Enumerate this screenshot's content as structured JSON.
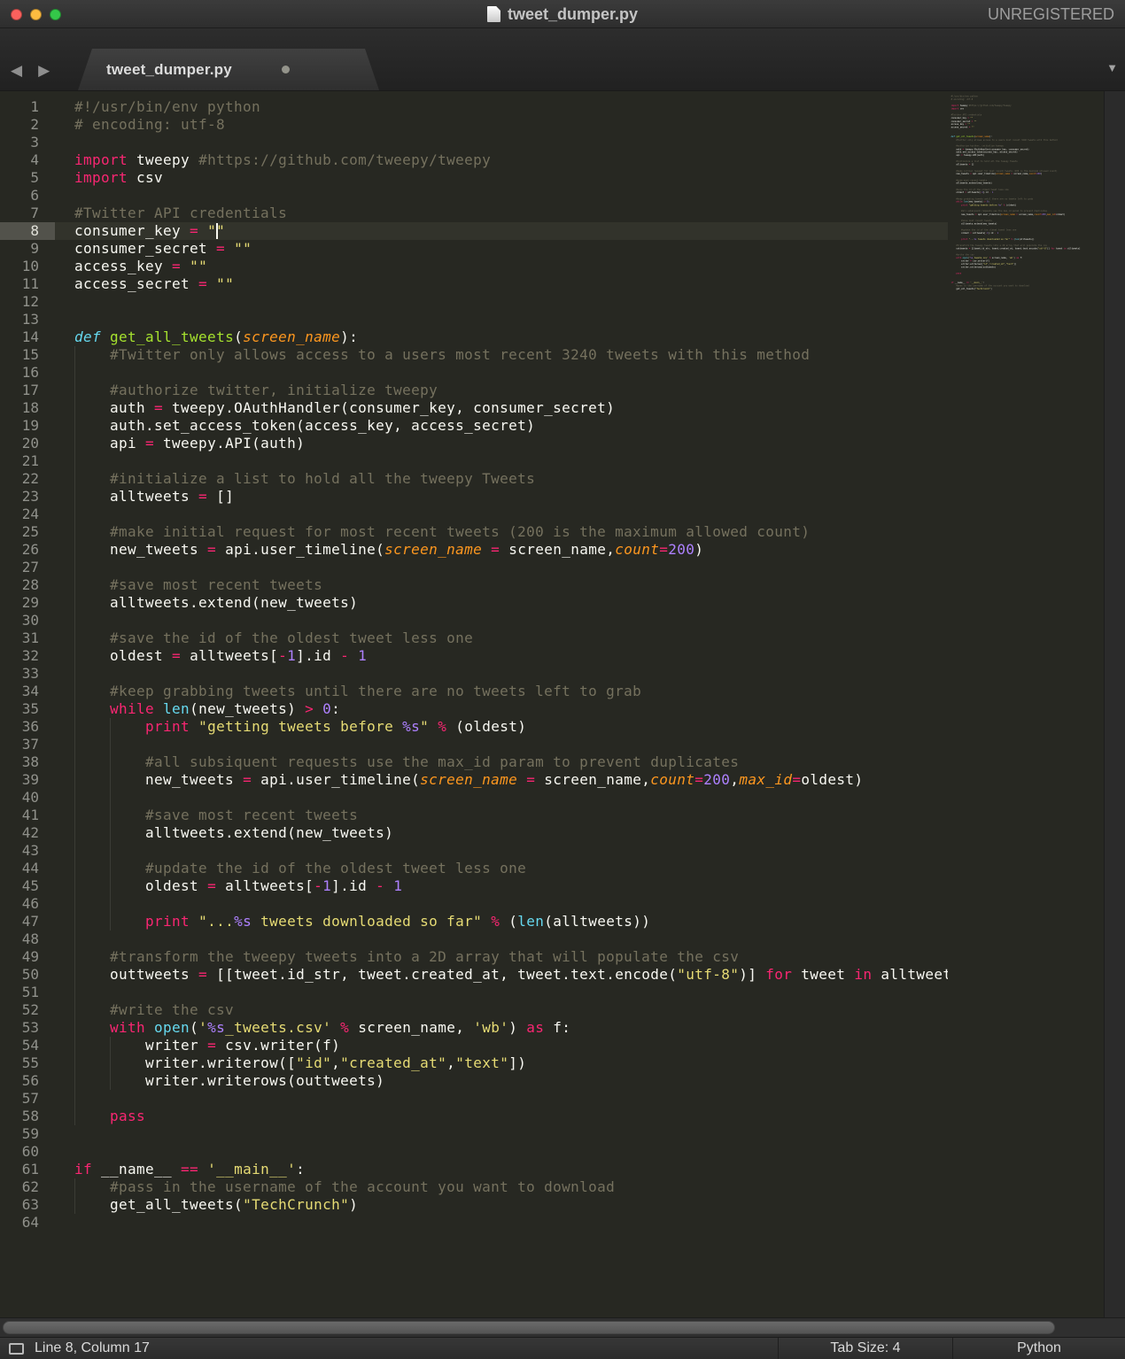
{
  "window": {
    "title": "tweet_dumper.py",
    "registration_status": "UNREGISTERED"
  },
  "icons": {
    "back": "◀",
    "forward": "▶",
    "overflow": "▼"
  },
  "tab_bar": {
    "active_tab": "tweet_dumper.py",
    "modified": true
  },
  "status_bar": {
    "cursor_position": "Line 8, Column 17",
    "tab_size": "Tab Size: 4",
    "syntax": "Python"
  },
  "theme": {
    "titlebar_text": "#C4C4C4",
    "close_button": "#FC615D",
    "minimize_button": "#FDBC40",
    "zoom_button": "#34C749",
    "editor_bg": "#272822",
    "fg": "#F8F8F2",
    "comment": "#75715E",
    "keyword": "#F92672",
    "string": "#E6DB74",
    "number": "#AE81FF",
    "func_def": "#A6E22E",
    "param": "#FD971F",
    "builtin": "#66D9EF",
    "gutter_text": "#90918B",
    "active_line_gutter": "#52524B",
    "active_line_bg": "#32332B",
    "indent_guide": "#3B3C35",
    "statusbar_text": "#D9D9D9"
  },
  "editor": {
    "active_line": 8,
    "cursor": {
      "line": 8,
      "column": 17
    },
    "lines": [
      {
        "ind": 0,
        "t": [
          [
            "c",
            "#!/usr/bin/env python"
          ]
        ]
      },
      {
        "ind": 0,
        "t": [
          [
            "c",
            "# encoding: utf-8"
          ]
        ]
      },
      {
        "ind": 0,
        "t": []
      },
      {
        "ind": 0,
        "t": [
          [
            "k",
            "import"
          ],
          [
            "p",
            " tweepy "
          ],
          [
            "c",
            "#https://github.com/tweepy/tweepy"
          ]
        ]
      },
      {
        "ind": 0,
        "t": [
          [
            "k",
            "import"
          ],
          [
            "p",
            " csv"
          ]
        ]
      },
      {
        "ind": 0,
        "t": []
      },
      {
        "ind": 0,
        "t": [
          [
            "c",
            "#Twitter API credentials"
          ]
        ]
      },
      {
        "ind": 0,
        "t": [
          [
            "p",
            "consumer_key "
          ],
          [
            "k",
            "="
          ],
          [
            "p",
            " "
          ],
          [
            "s",
            "\"\""
          ]
        ]
      },
      {
        "ind": 0,
        "t": [
          [
            "p",
            "consumer_secret "
          ],
          [
            "k",
            "="
          ],
          [
            "p",
            " "
          ],
          [
            "s",
            "\"\""
          ]
        ]
      },
      {
        "ind": 0,
        "t": [
          [
            "p",
            "access_key "
          ],
          [
            "k",
            "="
          ],
          [
            "p",
            " "
          ],
          [
            "s",
            "\"\""
          ]
        ]
      },
      {
        "ind": 0,
        "t": [
          [
            "p",
            "access_secret "
          ],
          [
            "k",
            "="
          ],
          [
            "p",
            " "
          ],
          [
            "s",
            "\"\""
          ]
        ]
      },
      {
        "ind": 0,
        "t": []
      },
      {
        "ind": 0,
        "t": []
      },
      {
        "ind": 0,
        "t": [
          [
            "d",
            "def"
          ],
          [
            "p",
            " "
          ],
          [
            "f",
            "get_all_tweets"
          ],
          [
            "p",
            "("
          ],
          [
            "a",
            "screen_name"
          ],
          [
            "p",
            "):"
          ]
        ]
      },
      {
        "ind": 1,
        "t": [
          [
            "c",
            "#Twitter only allows access to a users most recent 3240 tweets with this method"
          ]
        ]
      },
      {
        "ind": 1,
        "t": []
      },
      {
        "ind": 1,
        "t": [
          [
            "c",
            "#authorize twitter, initialize tweepy"
          ]
        ]
      },
      {
        "ind": 1,
        "t": [
          [
            "p",
            "auth "
          ],
          [
            "k",
            "="
          ],
          [
            "p",
            " tweepy.OAuthHandler(consumer_key, consumer_secret)"
          ]
        ]
      },
      {
        "ind": 1,
        "t": [
          [
            "p",
            "auth.set_access_token(access_key, access_secret)"
          ]
        ]
      },
      {
        "ind": 1,
        "t": [
          [
            "p",
            "api "
          ],
          [
            "k",
            "="
          ],
          [
            "p",
            " tweepy.API(auth)"
          ]
        ]
      },
      {
        "ind": 1,
        "t": []
      },
      {
        "ind": 1,
        "t": [
          [
            "c",
            "#initialize a list to hold all the tweepy Tweets"
          ]
        ]
      },
      {
        "ind": 1,
        "t": [
          [
            "p",
            "alltweets "
          ],
          [
            "k",
            "="
          ],
          [
            "p",
            " []"
          ]
        ]
      },
      {
        "ind": 1,
        "t": []
      },
      {
        "ind": 1,
        "t": [
          [
            "c",
            "#make initial request for most recent tweets (200 is the maximum allowed count)"
          ]
        ]
      },
      {
        "ind": 1,
        "t": [
          [
            "p",
            "new_tweets "
          ],
          [
            "k",
            "="
          ],
          [
            "p",
            " api.user_timeline("
          ],
          [
            "a",
            "screen_name"
          ],
          [
            "p",
            " "
          ],
          [
            "k",
            "="
          ],
          [
            "p",
            " screen_name,"
          ],
          [
            "a",
            "count"
          ],
          [
            "k",
            "="
          ],
          [
            "n",
            "200"
          ],
          [
            "p",
            ")"
          ]
        ]
      },
      {
        "ind": 1,
        "t": []
      },
      {
        "ind": 1,
        "t": [
          [
            "c",
            "#save most recent tweets"
          ]
        ]
      },
      {
        "ind": 1,
        "t": [
          [
            "p",
            "alltweets.extend(new_tweets)"
          ]
        ]
      },
      {
        "ind": 1,
        "t": []
      },
      {
        "ind": 1,
        "t": [
          [
            "c",
            "#save the id of the oldest tweet less one"
          ]
        ]
      },
      {
        "ind": 1,
        "t": [
          [
            "p",
            "oldest "
          ],
          [
            "k",
            "="
          ],
          [
            "p",
            " alltweets["
          ],
          [
            "k",
            "-"
          ],
          [
            "n",
            "1"
          ],
          [
            "p",
            "].id "
          ],
          [
            "k",
            "-"
          ],
          [
            "p",
            " "
          ],
          [
            "n",
            "1"
          ]
        ]
      },
      {
        "ind": 1,
        "t": []
      },
      {
        "ind": 1,
        "t": [
          [
            "c",
            "#keep grabbing tweets until there are no tweets left to grab"
          ]
        ]
      },
      {
        "ind": 1,
        "t": [
          [
            "k",
            "while"
          ],
          [
            "p",
            " "
          ],
          [
            "b",
            "len"
          ],
          [
            "p",
            "(new_tweets) "
          ],
          [
            "k",
            ">"
          ],
          [
            "p",
            " "
          ],
          [
            "n",
            "0"
          ],
          [
            "p",
            ":"
          ]
        ]
      },
      {
        "ind": 2,
        "t": [
          [
            "k",
            "print"
          ],
          [
            "p",
            " "
          ],
          [
            "s",
            "\"getting tweets before "
          ],
          [
            "m",
            "%s"
          ],
          [
            "s",
            "\""
          ],
          [
            "p",
            " "
          ],
          [
            "k",
            "%"
          ],
          [
            "p",
            " (oldest)"
          ]
        ]
      },
      {
        "ind": 2,
        "t": []
      },
      {
        "ind": 2,
        "t": [
          [
            "c",
            "#all subsiquent requests use the max_id param to prevent duplicates"
          ]
        ]
      },
      {
        "ind": 2,
        "t": [
          [
            "p",
            "new_tweets "
          ],
          [
            "k",
            "="
          ],
          [
            "p",
            " api.user_timeline("
          ],
          [
            "a",
            "screen_name"
          ],
          [
            "p",
            " "
          ],
          [
            "k",
            "="
          ],
          [
            "p",
            " screen_name,"
          ],
          [
            "a",
            "count"
          ],
          [
            "k",
            "="
          ],
          [
            "n",
            "200"
          ],
          [
            "p",
            ","
          ],
          [
            "a",
            "max_id"
          ],
          [
            "k",
            "="
          ],
          [
            "p",
            "oldest)"
          ]
        ]
      },
      {
        "ind": 2,
        "t": []
      },
      {
        "ind": 2,
        "t": [
          [
            "c",
            "#save most recent tweets"
          ]
        ]
      },
      {
        "ind": 2,
        "t": [
          [
            "p",
            "alltweets.extend(new_tweets)"
          ]
        ]
      },
      {
        "ind": 2,
        "t": []
      },
      {
        "ind": 2,
        "t": [
          [
            "c",
            "#update the id of the oldest tweet less one"
          ]
        ]
      },
      {
        "ind": 2,
        "t": [
          [
            "p",
            "oldest "
          ],
          [
            "k",
            "="
          ],
          [
            "p",
            " alltweets["
          ],
          [
            "k",
            "-"
          ],
          [
            "n",
            "1"
          ],
          [
            "p",
            "].id "
          ],
          [
            "k",
            "-"
          ],
          [
            "p",
            " "
          ],
          [
            "n",
            "1"
          ]
        ]
      },
      {
        "ind": 2,
        "t": []
      },
      {
        "ind": 2,
        "t": [
          [
            "k",
            "print"
          ],
          [
            "p",
            " "
          ],
          [
            "s",
            "\"..."
          ],
          [
            "m",
            "%s"
          ],
          [
            "s",
            " tweets downloaded so far\""
          ],
          [
            "p",
            " "
          ],
          [
            "k",
            "%"
          ],
          [
            "p",
            " ("
          ],
          [
            "b",
            "len"
          ],
          [
            "p",
            "(alltweets))"
          ]
        ]
      },
      {
        "ind": 1,
        "t": []
      },
      {
        "ind": 1,
        "t": [
          [
            "c",
            "#transform the tweepy tweets into a 2D array that will populate the csv"
          ]
        ]
      },
      {
        "ind": 1,
        "t": [
          [
            "p",
            "outtweets "
          ],
          [
            "k",
            "="
          ],
          [
            "p",
            " [[tweet.id_str, tweet.created_at, tweet.text.encode("
          ],
          [
            "s",
            "\"utf-8\""
          ],
          [
            "p",
            ")] "
          ],
          [
            "k",
            "for"
          ],
          [
            "p",
            " tweet "
          ],
          [
            "k",
            "in"
          ],
          [
            "p",
            " alltweets]"
          ]
        ]
      },
      {
        "ind": 1,
        "t": []
      },
      {
        "ind": 1,
        "t": [
          [
            "c",
            "#write the csv"
          ]
        ]
      },
      {
        "ind": 1,
        "t": [
          [
            "k",
            "with"
          ],
          [
            "p",
            " "
          ],
          [
            "b",
            "open"
          ],
          [
            "p",
            "("
          ],
          [
            "s",
            "'"
          ],
          [
            "m",
            "%s"
          ],
          [
            "s",
            "_tweets.csv'"
          ],
          [
            "p",
            " "
          ],
          [
            "k",
            "%"
          ],
          [
            "p",
            " screen_name, "
          ],
          [
            "s",
            "'wb'"
          ],
          [
            "p",
            ") "
          ],
          [
            "k",
            "as"
          ],
          [
            "p",
            " f:"
          ]
        ]
      },
      {
        "ind": 2,
        "t": [
          [
            "p",
            "writer "
          ],
          [
            "k",
            "="
          ],
          [
            "p",
            " csv.writer(f)"
          ]
        ]
      },
      {
        "ind": 2,
        "t": [
          [
            "p",
            "writer.writerow(["
          ],
          [
            "s",
            "\"id\""
          ],
          [
            "p",
            ","
          ],
          [
            "s",
            "\"created_at\""
          ],
          [
            "p",
            ","
          ],
          [
            "s",
            "\"text\""
          ],
          [
            "p",
            "])"
          ]
        ]
      },
      {
        "ind": 2,
        "t": [
          [
            "p",
            "writer.writerows(outtweets)"
          ]
        ]
      },
      {
        "ind": 1,
        "t": []
      },
      {
        "ind": 1,
        "t": [
          [
            "k",
            "pass"
          ]
        ]
      },
      {
        "ind": 0,
        "t": []
      },
      {
        "ind": 0,
        "t": []
      },
      {
        "ind": 0,
        "t": [
          [
            "k",
            "if"
          ],
          [
            "p",
            " __name__ "
          ],
          [
            "k",
            "=="
          ],
          [
            "p",
            " "
          ],
          [
            "s",
            "'__main__'"
          ],
          [
            "p",
            ":"
          ]
        ]
      },
      {
        "ind": 1,
        "t": [
          [
            "c",
            "#pass in the username of the account you want to download"
          ]
        ]
      },
      {
        "ind": 1,
        "t": [
          [
            "p",
            "get_all_tweets("
          ],
          [
            "s",
            "\"TechCrunch\""
          ],
          [
            "p",
            ")"
          ]
        ]
      },
      {
        "ind": 0,
        "t": []
      }
    ]
  }
}
